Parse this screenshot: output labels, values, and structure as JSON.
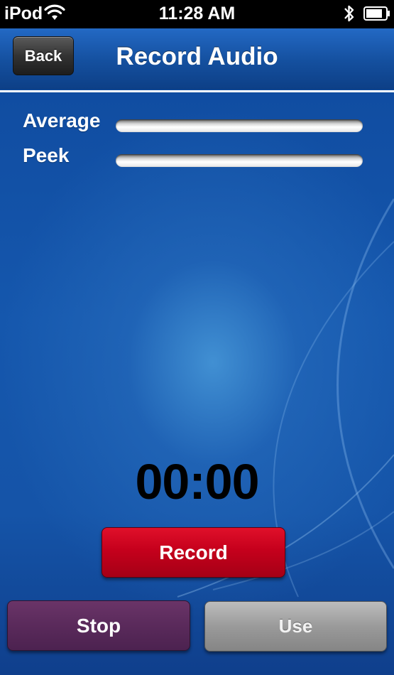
{
  "status_bar": {
    "carrier": "iPod",
    "time": "11:28 AM",
    "icons": [
      "wifi-icon",
      "bluetooth-icon",
      "battery-icon"
    ]
  },
  "nav": {
    "back_label": "Back",
    "title": "Record Audio"
  },
  "meters": [
    {
      "label": "Average",
      "level_fraction": 0
    },
    {
      "label": "Peek",
      "level_fraction": 0
    }
  ],
  "timer": "00:00",
  "buttons": {
    "record_label": "Record",
    "stop_label": "Stop",
    "use_label": "Use"
  },
  "colors": {
    "background_blue": "#1557ad",
    "record_red": "#c5001c",
    "stop_purple": "#5a2a5b",
    "use_gray": "#9a9a9a"
  }
}
